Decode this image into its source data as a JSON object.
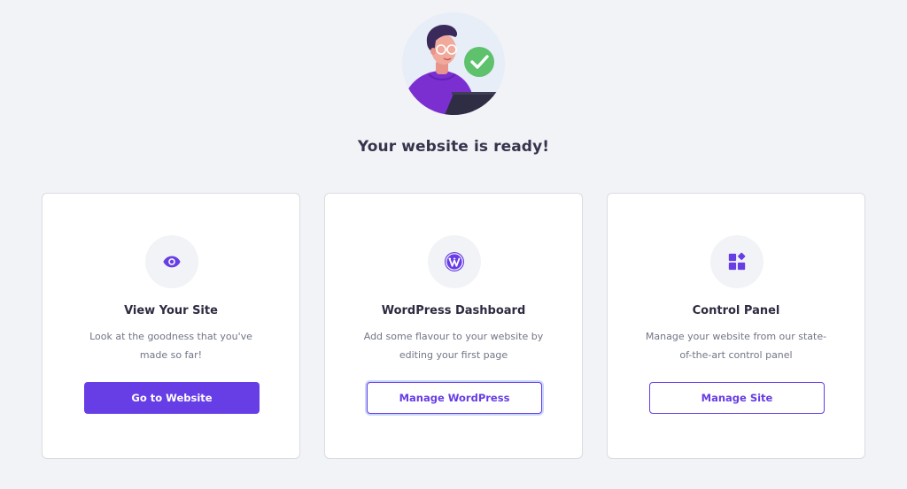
{
  "headline": "Your website is ready!",
  "colors": {
    "accent": "#673de6",
    "background": "#f2f3f6",
    "success": "#5ec16c"
  },
  "cards": [
    {
      "icon": "eye-icon",
      "title": "View Your Site",
      "description": "Look at the goodness that you've made so far!",
      "button_label": "Go to Website"
    },
    {
      "icon": "wordpress-icon",
      "title": "WordPress Dashboard",
      "description": "Add some flavour to your website by editing your first page",
      "button_label": "Manage WordPress"
    },
    {
      "icon": "control-panel-icon",
      "title": "Control Panel",
      "description": "Manage your website from our state-of-the-art control panel",
      "button_label": "Manage Site"
    }
  ]
}
